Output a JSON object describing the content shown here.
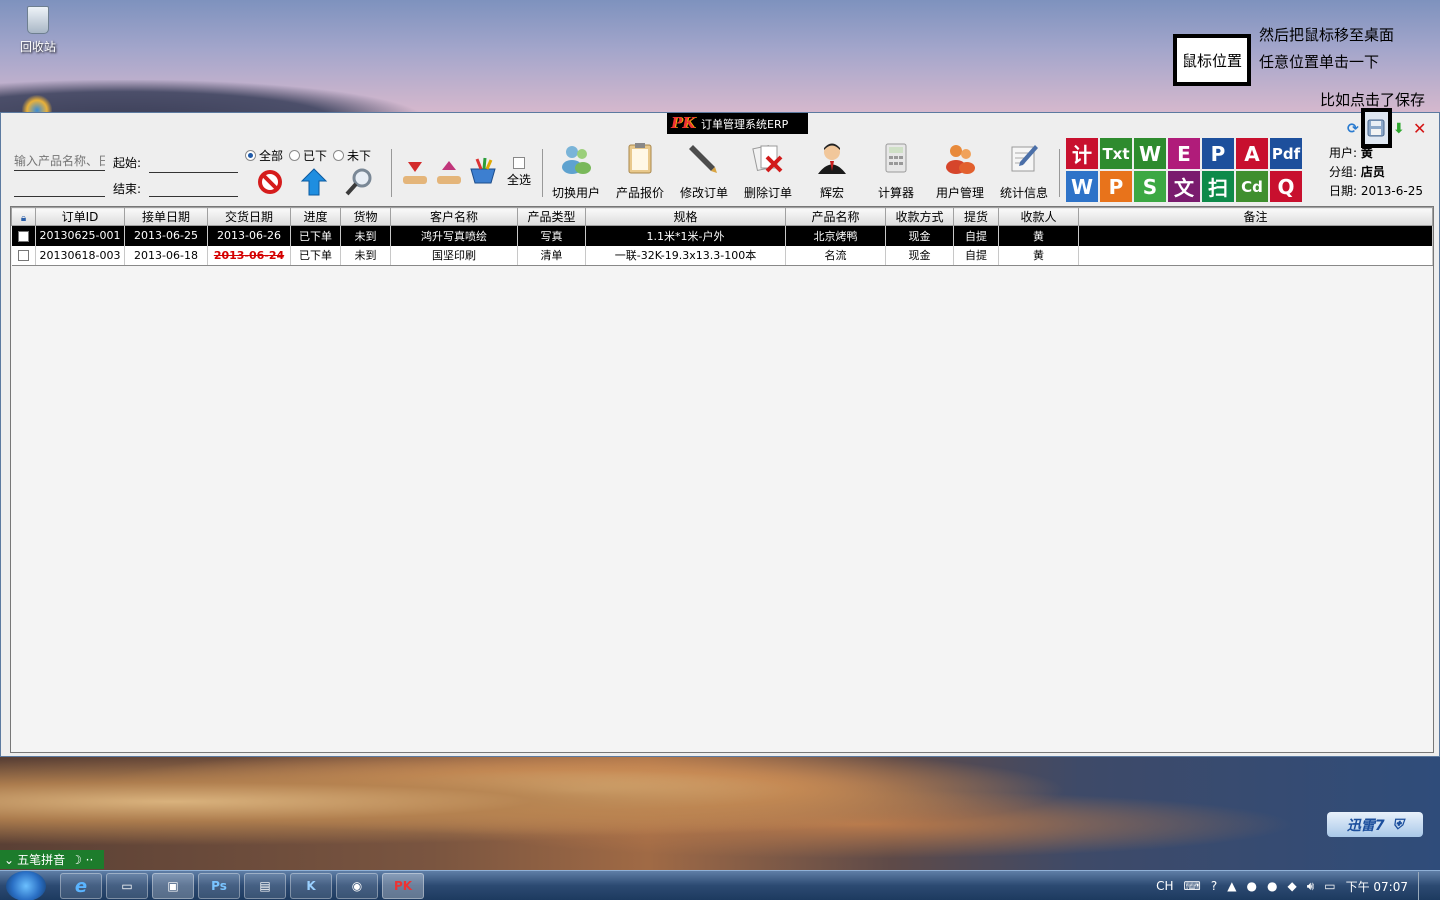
{
  "desktop": {
    "recycle_bin_label": "回收站",
    "annotation_box": "鼠标位置",
    "annotation_line1": "然后把鼠标移至桌面",
    "annotation_line2": "任意位置单击一下",
    "annotation_line3": "比如点击了保存"
  },
  "app": {
    "title": "订单管理系统ERP",
    "logo_text": "PK",
    "search": {
      "product_name_placeholder": "输入产品名称、日",
      "start_label": "起始:",
      "end_label": "结束:"
    },
    "filters": {
      "all": "全部",
      "placed": "已下",
      "not_placed": "未下",
      "select_all": "全选"
    },
    "toolbar": {
      "switch_user": "切换用户",
      "quote": "产品报价",
      "edit_order": "修改订单",
      "delete_order": "删除订单",
      "hui_hong": "辉宏",
      "calculator": "计算器",
      "user_mgmt": "用户管理",
      "stats": "统计信息"
    },
    "tiles": [
      "计",
      "Txt",
      "W",
      "E",
      "P",
      "A",
      "Pdf",
      "W",
      "P",
      "S",
      "文",
      "扫",
      "Cd",
      "Q"
    ],
    "user_info": {
      "user_label": "用户:",
      "user_value": "黄",
      "group_label": "分组:",
      "group_value": "店员",
      "date_label": "日期:",
      "date_value": "2013-6-25"
    },
    "table": {
      "headers": [
        "订单ID",
        "接单日期",
        "交货日期",
        "进度",
        "货物",
        "客户名称",
        "产品类型",
        "规格",
        "产品名称",
        "收款方式",
        "提货",
        "收款人",
        "备注"
      ],
      "rows": [
        [
          "20130625-001",
          "2013-06-25",
          "2013-06-26",
          "已下单",
          "未到",
          "鸿升写真喷绘",
          "写真",
          "1.1米*1米-户外",
          "北京烤鸭",
          "现金",
          "自提",
          "黄",
          ""
        ],
        [
          "20130618-003",
          "2013-06-18",
          "2013-06-24",
          "已下单",
          "未到",
          "国坚印刷",
          "清单",
          "一联-32K-19.3x13.3-100本",
          "名流",
          "现金",
          "自提",
          "黄",
          ""
        ]
      ]
    }
  },
  "taskbar": {
    "ime": "五笔拼音",
    "xunlei": "迅雷7",
    "lang": "CH",
    "clock": "下午 07:07"
  }
}
